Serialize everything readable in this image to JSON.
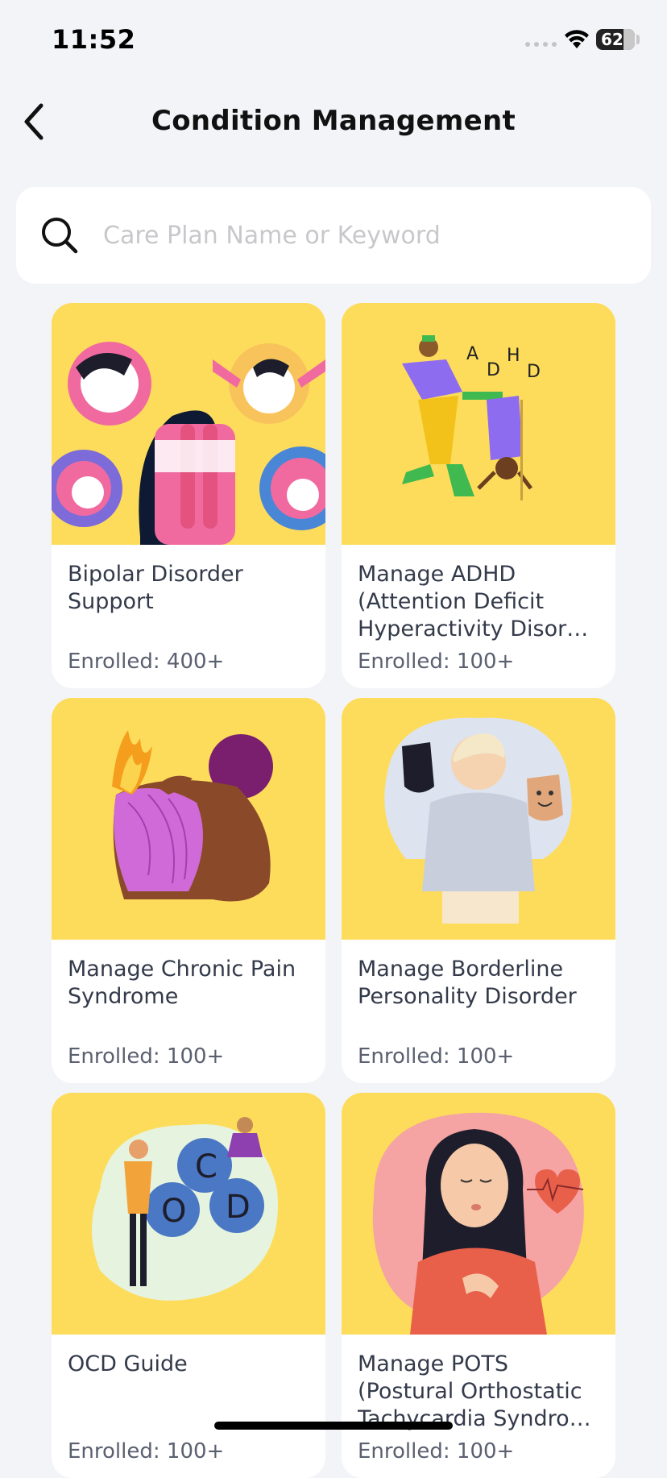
{
  "status": {
    "time": "11:52",
    "battery": "62"
  },
  "nav": {
    "title": "Condition Management"
  },
  "search": {
    "placeholder": "Care Plan Name or Keyword"
  },
  "cards": [
    {
      "title": "Bipolar Disorder Support",
      "enrolled": "Enrolled: 400+"
    },
    {
      "title": "Manage ADHD (Attention Deficit Hyperactivity Disor…",
      "enrolled": "Enrolled: 100+"
    },
    {
      "title": "Manage Chronic Pain Syndrome",
      "enrolled": "Enrolled: 100+"
    },
    {
      "title": "Manage Borderline Personality Disorder",
      "enrolled": "Enrolled: 100+"
    },
    {
      "title": "OCD Guide",
      "enrolled": "Enrolled: 100+"
    },
    {
      "title": "Manage POTS (Postural Orthostatic Tachycardia Syndro…",
      "enrolled": "Enrolled: 100+"
    }
  ],
  "art_text": {
    "adhd": [
      "A",
      "D",
      "H",
      "D"
    ],
    "ocd": [
      "C",
      "O",
      "D"
    ]
  },
  "colors": {
    "card_art_bg": "#fddc5c",
    "background": "#f3f4f8",
    "text": "#333a4a"
  },
  "icons": [
    "back-chevron-icon",
    "search-icon",
    "wifi-icon",
    "battery-icon"
  ]
}
